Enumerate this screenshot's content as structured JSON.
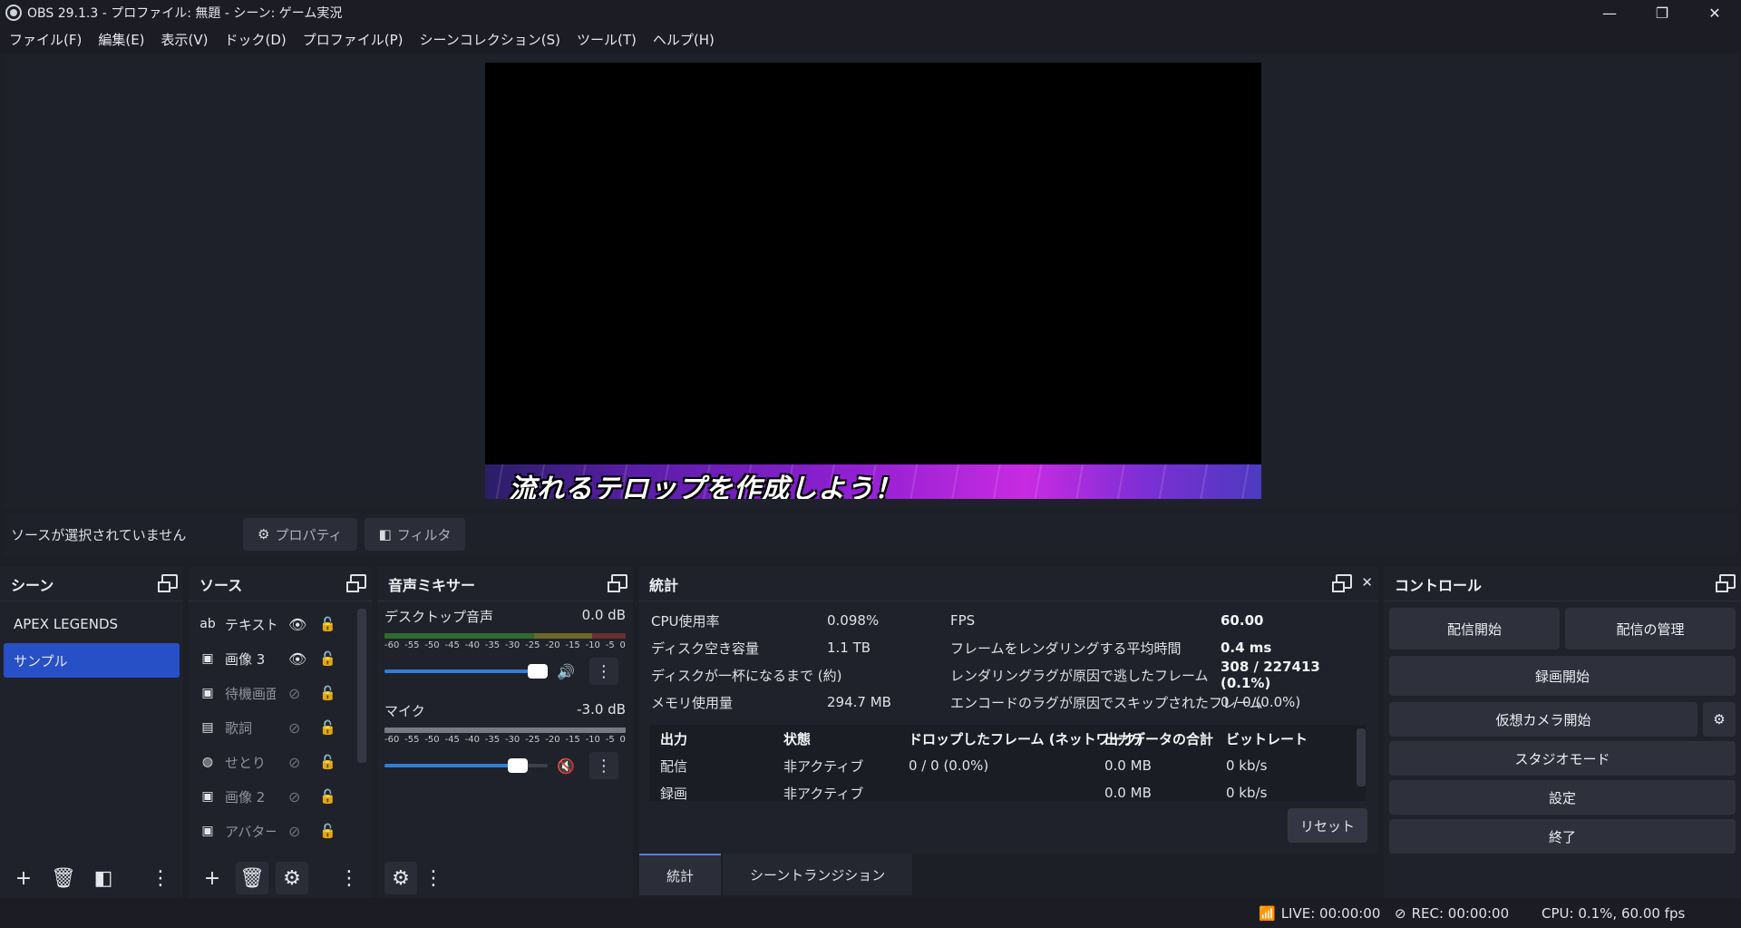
{
  "window": {
    "title": "OBS 29.1.3 - プロファイル: 無題 - シーン: ゲーム実況",
    "minimize": "—",
    "restore": "❐",
    "close": "✕"
  },
  "menu": [
    "ファイル(F)",
    "編集(E)",
    "表示(V)",
    "ドック(D)",
    "プロファイル(P)",
    "シーンコレクション(S)",
    "ツール(T)",
    "ヘルプ(H)"
  ],
  "preview": {
    "ticker_text": "流れるテロップを作成しよう！"
  },
  "source_toolbar": {
    "no_source": "ソースが選択されていません",
    "properties": "プロパティ",
    "filters": "フィルタ"
  },
  "scenes": {
    "title": "シーン",
    "items": [
      {
        "label": "APEX LEGENDS",
        "selected": false
      },
      {
        "label": "サンプル",
        "selected": true
      }
    ]
  },
  "sources": {
    "title": "ソース",
    "items": [
      {
        "icon": "text-icon",
        "glyph": "ab",
        "label": "テキスト（",
        "visible": true
      },
      {
        "icon": "image-icon",
        "glyph": "▣",
        "label": "画像 3",
        "visible": true
      },
      {
        "icon": "image-icon",
        "glyph": "▣",
        "label": "待機画面",
        "visible": false
      },
      {
        "icon": "media-icon",
        "glyph": "▤",
        "label": "歌詞",
        "visible": false
      },
      {
        "icon": "browser-icon",
        "glyph": "◍",
        "label": "せとり",
        "visible": false
      },
      {
        "icon": "image-icon",
        "glyph": "▣",
        "label": "画像 2",
        "visible": false
      },
      {
        "icon": "image-icon",
        "glyph": "▣",
        "label": "アバター",
        "visible": false
      }
    ]
  },
  "mixer": {
    "title": "音声ミキサー",
    "scale": [
      "-60",
      "-55",
      "-50",
      "-45",
      "-40",
      "-35",
      "-30",
      "-25",
      "-20",
      "-15",
      "-10",
      "-5",
      "0"
    ],
    "channels": [
      {
        "name": "デスクトップ音声",
        "db": "0.0 dB",
        "level": 0.95,
        "muted": false
      },
      {
        "name": "マイク",
        "db": "-3.0 dB",
        "level": 0.82,
        "muted": true
      }
    ]
  },
  "stats": {
    "title": "統計",
    "left": [
      {
        "label": "CPU使用率",
        "value": "0.098%"
      },
      {
        "label": "ディスク空き容量",
        "value": "1.1 TB"
      },
      {
        "label": "ディスクが一杯になるまで (約)",
        "value": ""
      },
      {
        "label": "メモリ使用量",
        "value": "294.7 MB"
      }
    ],
    "right": [
      {
        "label": "FPS",
        "value": "60.00"
      },
      {
        "label": "フレームをレンダリングする平均時間",
        "value": "0.4 ms"
      },
      {
        "label": "レンダリングラグが原因で逃したフレーム",
        "value": "308 / 227413 (0.1%)"
      },
      {
        "label": "エンコードのラグが原因でスキップされたフレーム",
        "value": "0 / 0 (0.0%)"
      }
    ],
    "table_headers": [
      "出力",
      "状態",
      "ドロップしたフレーム (ネットワーク)",
      "出力データの合計",
      "ビットレート"
    ],
    "table_rows": [
      [
        "配信",
        "非アクティブ",
        "0 / 0 (0.0%)",
        "0.0 MB",
        "0 kb/s"
      ],
      [
        "録画",
        "非アクティブ",
        "",
        "0.0 MB",
        "0 kb/s"
      ]
    ],
    "reset": "リセット"
  },
  "tabs": [
    "統計",
    "シーントランジション"
  ],
  "controls": {
    "title": "コントロール",
    "start_stream": "配信開始",
    "manage_stream": "配信の管理",
    "start_record": "録画開始",
    "start_vcam": "仮想カメラ開始",
    "studio_mode": "スタジオモード",
    "settings": "設定",
    "exit": "終了"
  },
  "status": {
    "live": "LIVE: 00:00:00",
    "rec": "REC: 00:00:00",
    "cpu": "CPU: 0.1%, 60.00 fps"
  }
}
